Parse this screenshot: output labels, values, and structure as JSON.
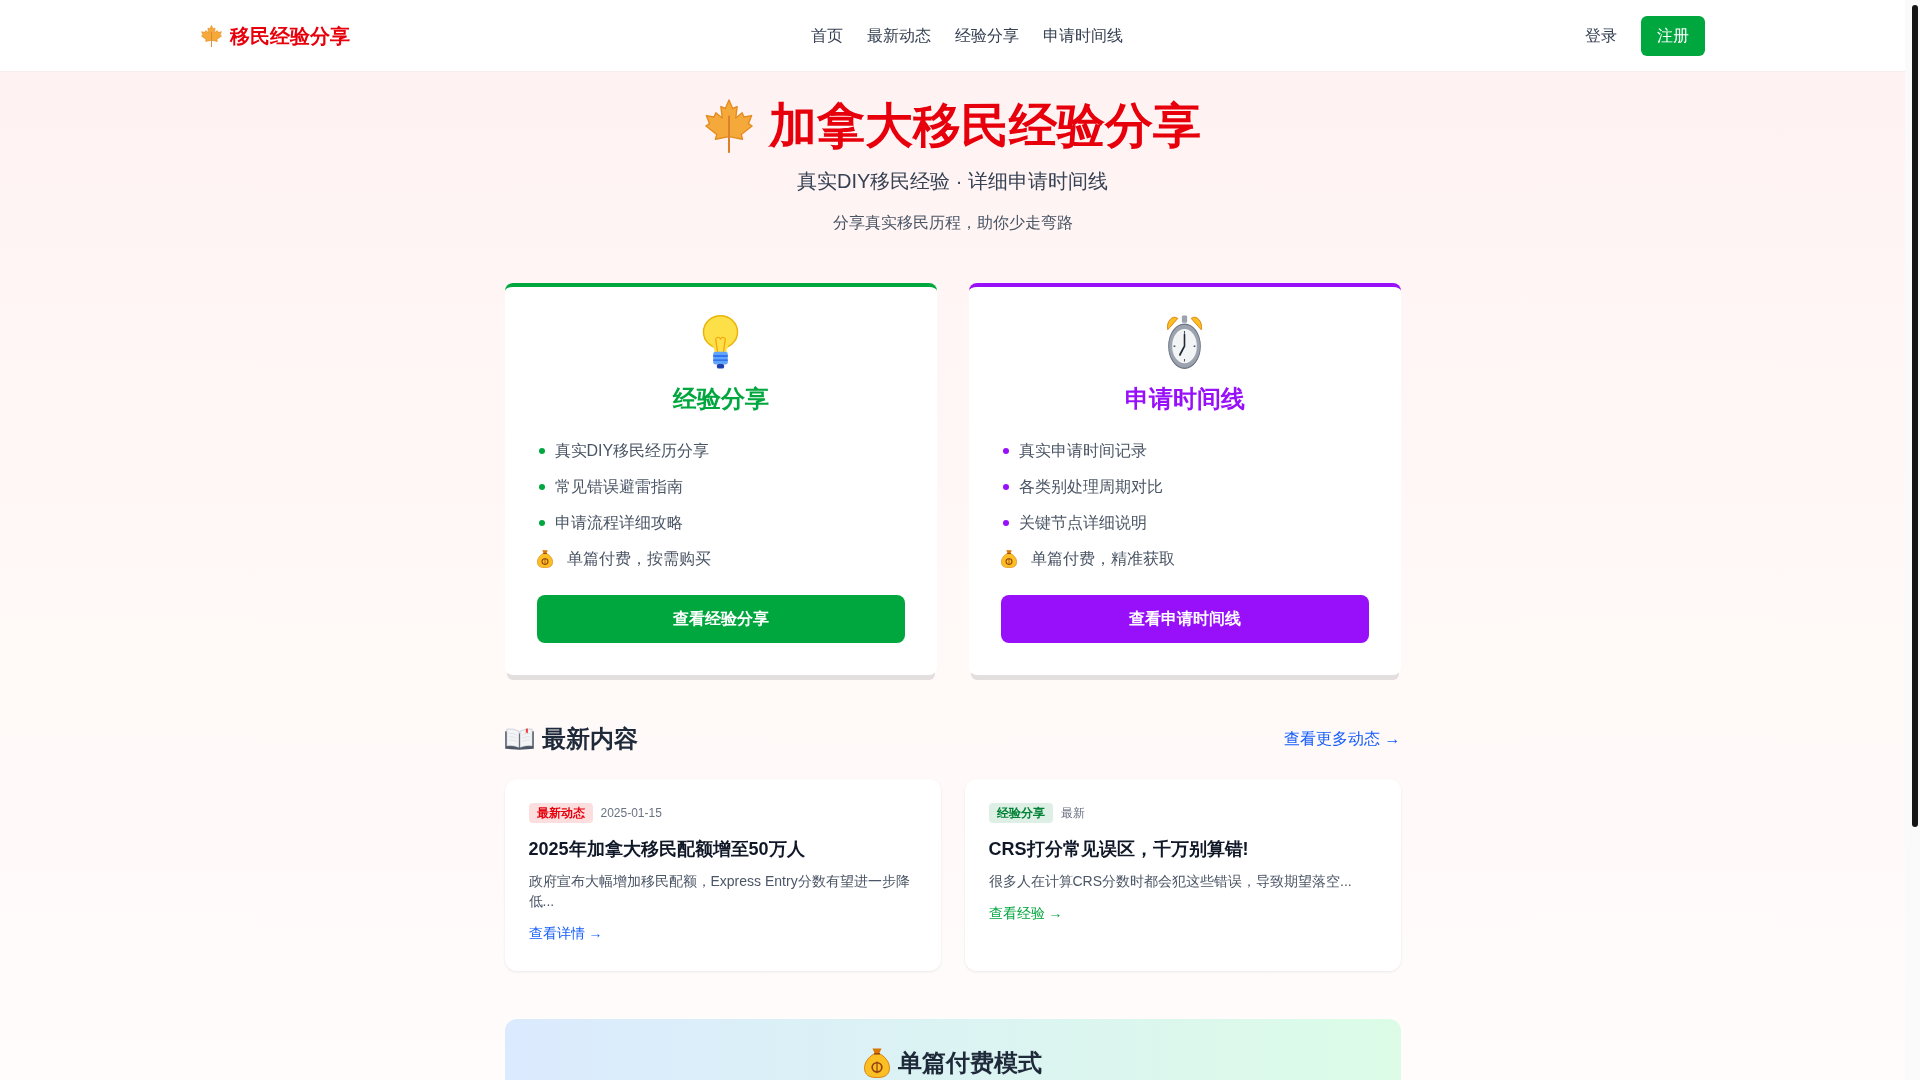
{
  "header": {
    "logo": "移民经验分享",
    "nav": [
      "首页",
      "最新动态",
      "经验分享",
      "申请时间线"
    ],
    "login": "登录",
    "register": "注册"
  },
  "hero": {
    "title": "加拿大移民经验分享",
    "subtitle": "真实DIY移民经验 · 详细申请时间线",
    "tagline": "分享真实移民历程，助你少走弯路"
  },
  "cards": [
    {
      "kind": "experience",
      "color": "#00a63e",
      "title": "经验分享",
      "items": [
        {
          "kind": "bullet",
          "text": "真实DIY移民经历分享"
        },
        {
          "kind": "bullet",
          "text": "常见错误避雷指南"
        },
        {
          "kind": "bullet",
          "text": "申请流程详细攻略"
        },
        {
          "kind": "pricing",
          "text": "单篇付费，按需购买"
        }
      ],
      "button": "查看经验分享"
    },
    {
      "kind": "timeline",
      "color": "#9810fa",
      "title": "申请时间线",
      "items": [
        {
          "kind": "bullet",
          "text": "真实申请时间记录"
        },
        {
          "kind": "bullet",
          "text": "各类别处理周期对比"
        },
        {
          "kind": "bullet",
          "text": "关键节点详细说明"
        },
        {
          "kind": "pricing",
          "text": "单篇付费，精准获取"
        }
      ],
      "button": "查看申请时间线"
    }
  ],
  "latest": {
    "title": "最新内容",
    "more_link": "查看更多动态 →",
    "posts": [
      {
        "tag": {
          "label": "最新动态",
          "color": "#e7000b"
        },
        "meta": "2025-01-15",
        "title": "2025年加拿大移民配额增至50万人",
        "excerpt": "政府宣布大幅增加移民配额，Express Entry分数有望进一步降低...",
        "link": {
          "label": "查看详情 →",
          "color": "#155dfc"
        }
      },
      {
        "tag": {
          "label": "经验分享",
          "color": "#008236"
        },
        "meta": "最新",
        "title": "CRS打分常见误区，千万别算错!",
        "excerpt": "很多人在计算CRS分数时都会犯这些错误，导致期望落空...",
        "link": {
          "label": "查看经验 →",
          "color": "#00a63e"
        }
      }
    ]
  },
  "pricing": {
    "title": "单篇付费模式"
  }
}
